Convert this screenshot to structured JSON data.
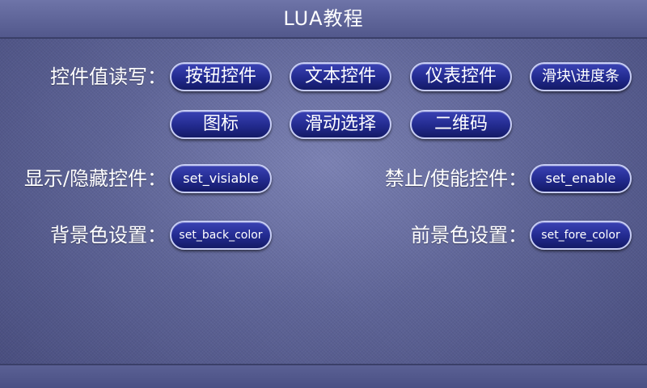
{
  "header": {
    "title": "LUA教程"
  },
  "rows": {
    "control_rw": {
      "label": "控件值读写：",
      "buttons": [
        "按钮控件",
        "文本控件",
        "仪表控件",
        "滑块\\进度条",
        "图标",
        "滑动选择",
        "二维码"
      ]
    },
    "visibility": {
      "label": "显示/隐藏控件：",
      "button": "set_visiable"
    },
    "enable": {
      "label": "禁止/使能控件：",
      "button": "set_enable"
    },
    "back_color": {
      "label": "背景色设置：",
      "button": "set_back_color"
    },
    "fore_color": {
      "label": "前景色设置：",
      "button": "set_fore_color"
    }
  },
  "colors": {
    "background": "#5f6598",
    "button_fill": "#222a8e",
    "button_border": "#c7cdf4",
    "text": "#ffffff"
  }
}
